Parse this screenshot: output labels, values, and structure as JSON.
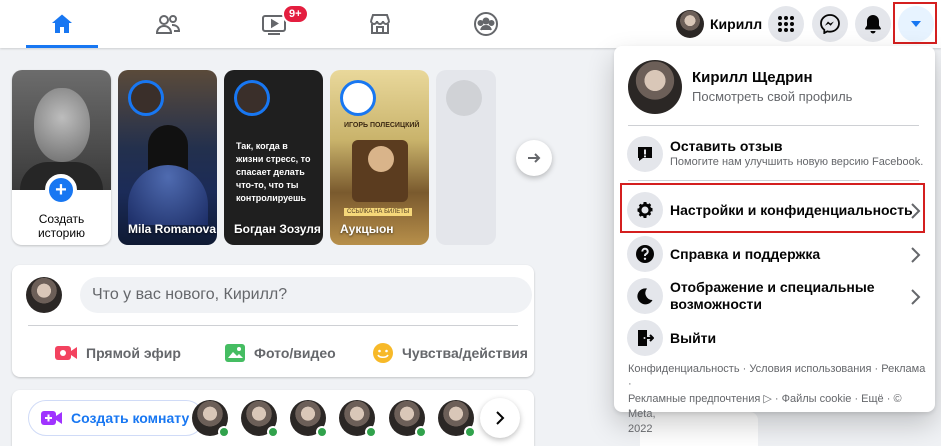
{
  "nav": {
    "badge": "9+",
    "profile_name": "Кирилл"
  },
  "stories": {
    "create_label_1": "Создать",
    "create_label_2": "историю",
    "items": [
      {
        "name": "Mila Romanova"
      },
      {
        "name": "Богдан Зозуля",
        "text": "Так, когда в жизни стресс, то спасает делать что-то, что ты контролируешь"
      },
      {
        "name": "Аукцыон",
        "top_text": "ИГОРЬ ПОЛЕСИЦКИЙ",
        "caption": "ССЫЛКА НА БИЛЕТЫ"
      }
    ]
  },
  "composer": {
    "placeholder": "Что у вас нового, Кирилл?",
    "live": "Прямой эфир",
    "photo": "Фото/видео",
    "feeling": "Чувства/действия"
  },
  "rooms": {
    "create": "Создать комнату"
  },
  "menu": {
    "profile_name": "Кирилл Щедрин",
    "profile_sub": "Посмотреть свой профиль",
    "feedback_title": "Оставить отзыв",
    "feedback_desc": "Помогите нам улучшить новую версию Facebook.",
    "settings": "Настройки и конфиденциальность",
    "help": "Справка и поддержка",
    "display_1": "Отображение и специальные",
    "display_2": "возможности",
    "logout": "Выйти",
    "footer_1": "Конфиденциальность · Условия использования · Реклама ·",
    "footer_2": "Рекламные предпочтения ▷ · Файлы cookie · Ещё · © Meta,",
    "footer_3": "2022"
  },
  "colors": {
    "accent": "#1877f2",
    "highlight": "#d41f1f",
    "online": "#31a24c"
  }
}
